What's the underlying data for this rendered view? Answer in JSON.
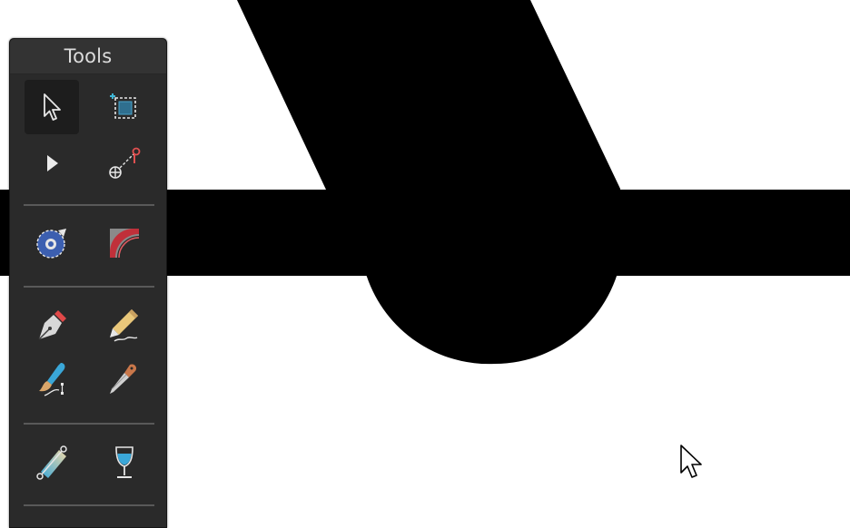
{
  "panel": {
    "title": "Tools"
  },
  "tools": [
    {
      "name": "move-tool",
      "icon": "arrow-pointer-icon",
      "selected": true
    },
    {
      "name": "artboard-tool",
      "icon": "artboard-icon",
      "selected": false
    },
    {
      "name": "node-tool",
      "icon": "node-pointer-icon",
      "selected": false
    },
    {
      "name": "point-transform-tool",
      "icon": "point-transform-icon",
      "selected": false
    },
    {
      "name": "contour-tool",
      "icon": "contour-icon",
      "selected": false
    },
    {
      "name": "corner-tool",
      "icon": "corner-icon",
      "selected": false
    },
    {
      "name": "pen-tool",
      "icon": "pen-nib-icon",
      "selected": false
    },
    {
      "name": "pencil-tool",
      "icon": "pencil-icon",
      "selected": false
    },
    {
      "name": "vector-brush-tool",
      "icon": "vector-brush-icon",
      "selected": false
    },
    {
      "name": "knife-tool",
      "icon": "knife-icon",
      "selected": false
    },
    {
      "name": "fill-tool",
      "icon": "gradient-fill-icon",
      "selected": false
    },
    {
      "name": "transparency-tool",
      "icon": "wine-glass-icon",
      "selected": false
    }
  ],
  "colors": {
    "panel_bg": "#2a2a2a",
    "canvas_bg": "#ffffff",
    "shape_fill": "#000000",
    "accent_red": "#e04848",
    "accent_blue": "#3aa7d8"
  }
}
